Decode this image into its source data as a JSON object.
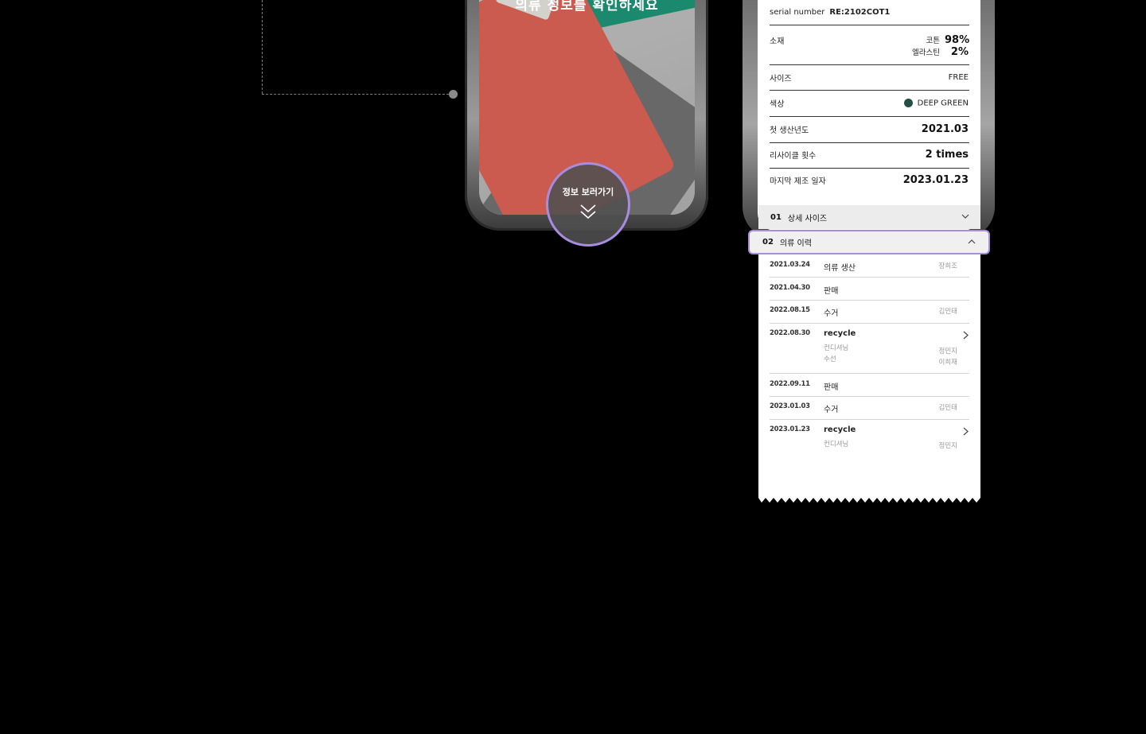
{
  "left_phone": {
    "headline": "의류 정보를 확인하세요",
    "view_info_label": "정보 보러가기"
  },
  "receipt": {
    "serial_label": "serial number",
    "serial_value": "RE:2102COT1",
    "material_label": "소재",
    "materials": [
      {
        "name": "코튼",
        "pct": "98%"
      },
      {
        "name": "엘라스틴",
        "pct": "2%"
      }
    ],
    "size_label": "사이즈",
    "size_value": "FREE",
    "color_label": "색상",
    "color_value": "DEEP GREEN",
    "color_hex": "#244f44",
    "first_year_label": "첫 생산년도",
    "first_year_value": "2021.03",
    "recycle_count_label": "리사이클 횟수",
    "recycle_count_value": "2 times",
    "last_date_label": "마지막 제조 일자",
    "last_date_value": "2023.01.23",
    "accordion": [
      {
        "num": "01",
        "title": "상세 사이즈"
      },
      {
        "num": "02",
        "title": "의류 이력"
      }
    ],
    "history": [
      {
        "date": "2021.03.24",
        "event": "의류 생산",
        "person": "장희조"
      },
      {
        "date": "2021.04.30",
        "event": "판매",
        "person": ""
      },
      {
        "date": "2022.08.15",
        "event": "수거",
        "person": "김민태"
      },
      {
        "date": "2022.08.30",
        "event": "recycle",
        "sub1": "컨디셔닝",
        "sub1_person": "정민지",
        "sub2": "수선",
        "sub2_person": "이희재"
      },
      {
        "date": "2022.09.11",
        "event": "판매",
        "person": ""
      },
      {
        "date": "2023.01.03",
        "event": "수거",
        "person": "김민태"
      },
      {
        "date": "2023.01.23",
        "event": "recycle",
        "sub1": "컨디셔닝",
        "sub1_person": "정민지"
      }
    ]
  },
  "colors": {
    "accent_purple": "#a88ce0",
    "background": "#000000"
  }
}
